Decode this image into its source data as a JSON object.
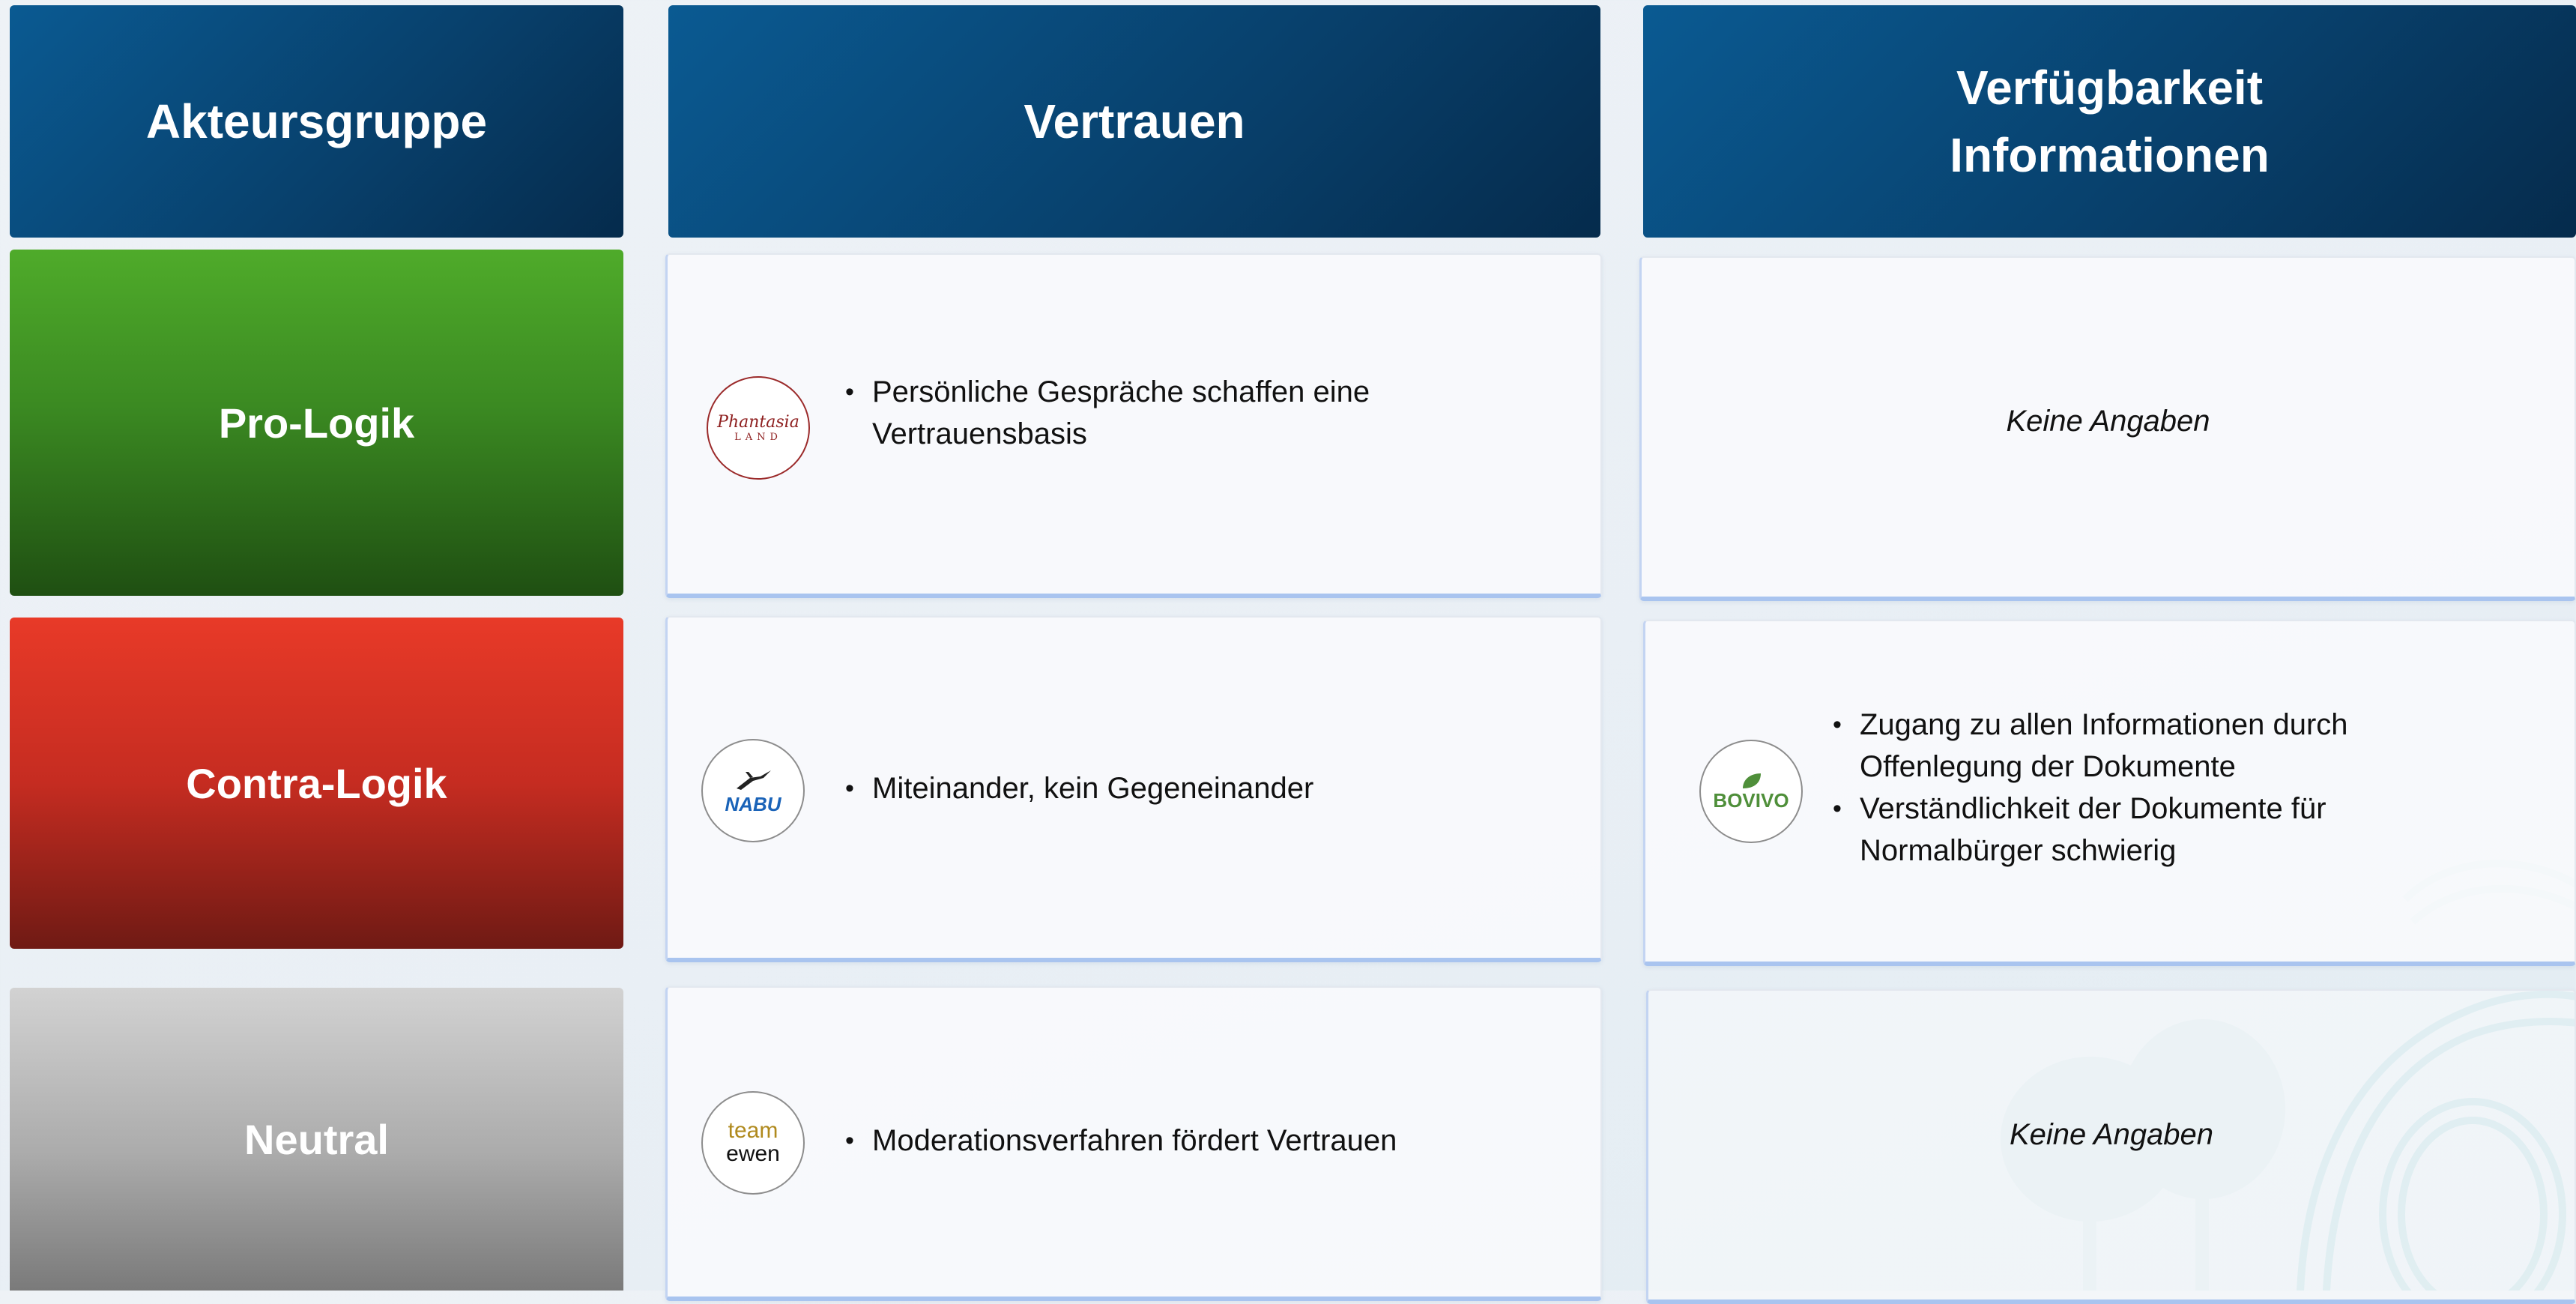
{
  "headers": {
    "col1": "Akteursgruppe",
    "col2": "Vertrauen",
    "col3_line1": "Verfügbarkeit",
    "col3_line2": "Informationen"
  },
  "groups": {
    "pro": "Pro-Logik",
    "contra": "Contra-Logik",
    "neutral": "Neutral"
  },
  "rows": {
    "pro": {
      "logo_icon": "phantasialand-logo",
      "logo_text_top": "Phantasia",
      "logo_text_bottom": "LAND",
      "vertrauen": [
        "Persönliche Gespräche schaffen eine",
        "Vertrauensbasis"
      ],
      "verfuegbarkeit": "Keine Angaben"
    },
    "contra": {
      "logo_icon": "nabu-logo",
      "logo_text": "NABU",
      "vertrauen": [
        "Miteinander, kein Gegeneinander"
      ],
      "logo2_icon": "bovivo-logo",
      "logo2_text": "BOVIVO",
      "verfuegbarkeit": {
        "item1_line1": "Zugang zu allen Informationen durch",
        "item1_line2": "Offenlegung der Dokumente",
        "item2_line1": "Verständlichkeit der Dokumente für",
        "item2_line2": "Normalbürger schwierig"
      }
    },
    "neutral": {
      "logo_icon": "team-ewen-logo",
      "logo_text_top": "team",
      "logo_text_bottom": "ewen",
      "vertrauen": [
        "Moderationsverfahren fördert Vertrauen"
      ],
      "verfuegbarkeit": "Keine Angaben"
    }
  },
  "colors": {
    "header": "#0a5a92",
    "pro": "#4fab2a",
    "contra": "#e83a28",
    "neutral": "#d2d2d2",
    "card_accent": "#a9c4ef"
  }
}
